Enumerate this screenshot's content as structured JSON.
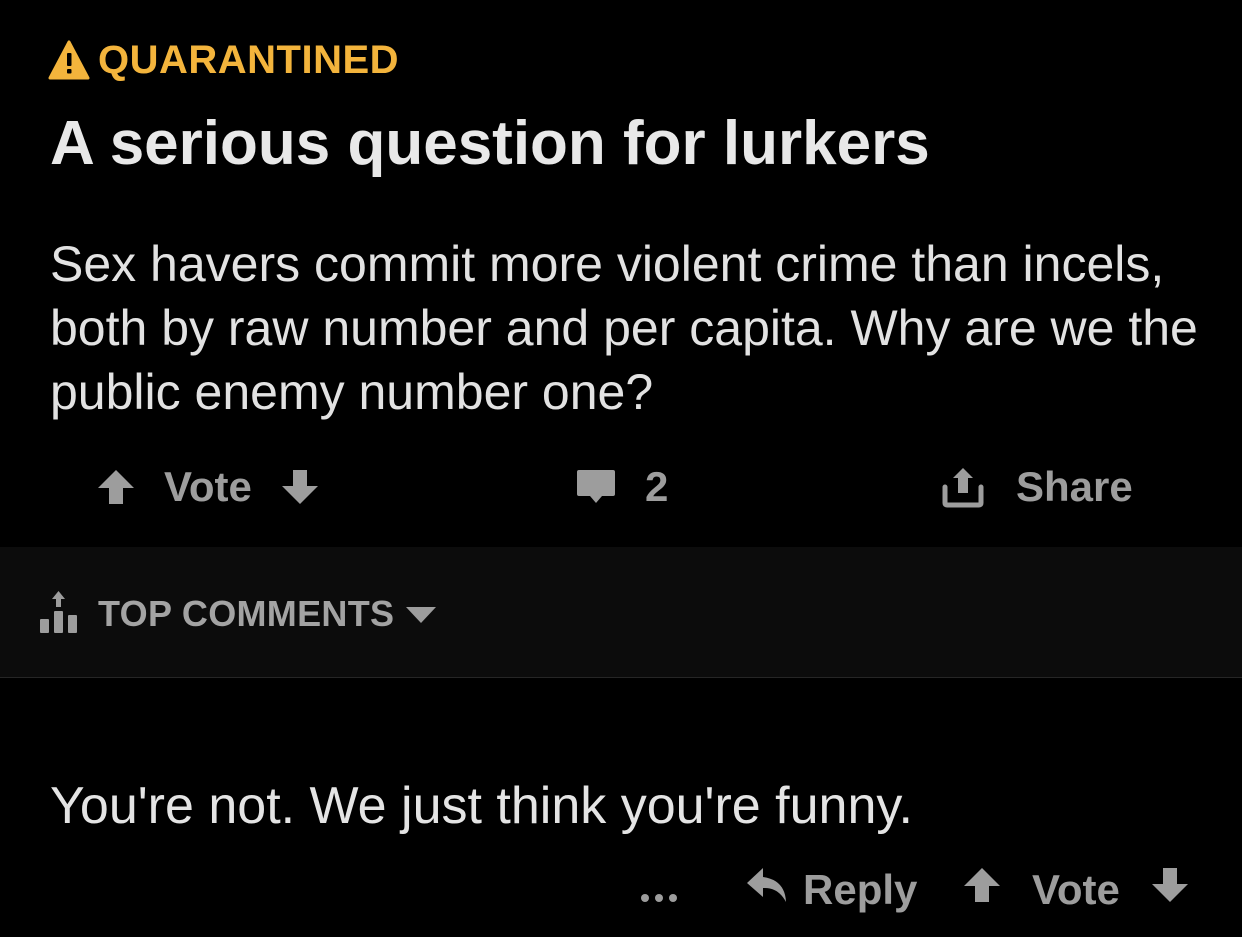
{
  "post": {
    "quarantine_label": "QUARANTINED",
    "title": "A serious question for lurkers",
    "body": "Sex havers commit more violent crime than incels, both by raw number and per capita. Why are we the public enemy number one?",
    "vote_label": "Vote",
    "comment_count": "2",
    "share_label": "Share"
  },
  "sort": {
    "label": "TOP COMMENTS"
  },
  "comment": {
    "text": "You're not. We just think you're funny.",
    "reply_label": "Reply",
    "vote_label": "Vote"
  },
  "colors": {
    "background": "#000000",
    "quarantine_accent": "#f3b43c",
    "muted_text": "#9d9d9d",
    "primary_text": "#e6e6e6",
    "sort_bar_bg": "#0c0c0c"
  },
  "icons": {
    "quarantine": "warning-triangle-icon",
    "upvote": "arrow-up-icon",
    "downvote": "arrow-down-icon",
    "comments": "speech-bubble-icon",
    "share": "share-upload-icon",
    "sort": "bar-chart-arrow-icon",
    "caret": "caret-down-icon",
    "more": "ellipsis-icon",
    "reply": "reply-arrow-icon"
  }
}
